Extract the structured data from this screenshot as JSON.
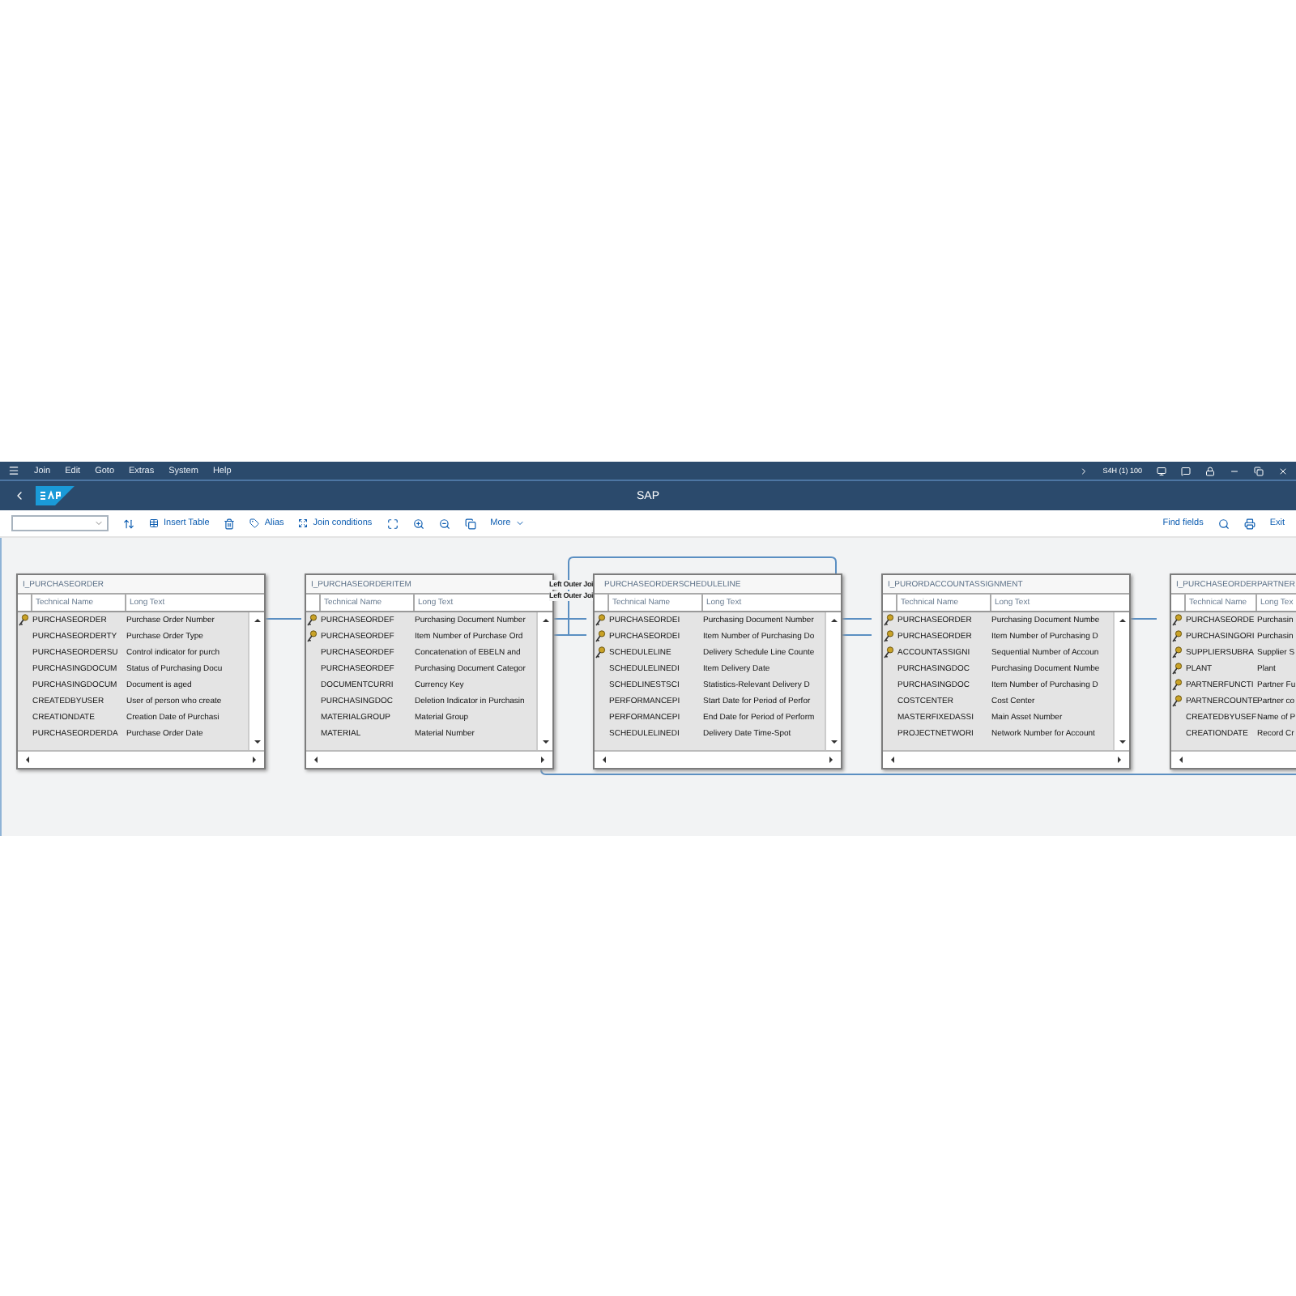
{
  "menu": [
    "Join",
    "Edit",
    "Goto",
    "Extras",
    "System",
    "Help"
  ],
  "system_info": "S4H (1) 100",
  "window": {
    "title": "SAP"
  },
  "toolbar": {
    "left": [
      {
        "kind": "select"
      },
      {
        "kind": "icon"
      },
      {
        "kind": "button",
        "label": "Insert Table"
      },
      {
        "kind": "icon"
      },
      {
        "kind": "button",
        "label": "Alias"
      },
      {
        "kind": "button",
        "label": "Join conditions"
      },
      {
        "kind": "icon"
      },
      {
        "kind": "icon"
      },
      {
        "kind": "icon"
      },
      {
        "kind": "icon"
      },
      {
        "kind": "menu",
        "label": "More"
      }
    ],
    "right": [
      {
        "kind": "link",
        "label": "Find fields"
      },
      {
        "kind": "icon"
      },
      {
        "kind": "icon"
      },
      {
        "kind": "link",
        "label": "Exit"
      }
    ]
  },
  "join_labels": [
    "Left Outer Joi",
    "Left Outer Joi"
  ],
  "tables": [
    {
      "name": "I_PURCHASEORDER",
      "columns": [
        "Technical Name",
        "Long Text"
      ],
      "rows": [
        {
          "key": true,
          "technical_name": "PURCHASEORDER",
          "long_text": "Purchase Order Number"
        },
        {
          "key": false,
          "technical_name": "PURCHASEORDERTY",
          "long_text": "Purchase Order Type"
        },
        {
          "key": false,
          "technical_name": "PURCHASEORDERSU",
          "long_text": "Control indicator for purch"
        },
        {
          "key": false,
          "technical_name": "PURCHASINGDOCUM",
          "long_text": "Status of Purchasing Docu"
        },
        {
          "key": false,
          "technical_name": "PURCHASINGDOCUM",
          "long_text": "Document is aged"
        },
        {
          "key": false,
          "technical_name": "CREATEDBYUSER",
          "long_text": "User of person who create"
        },
        {
          "key": false,
          "technical_name": "CREATIONDATE",
          "long_text": "Creation Date of Purchasi"
        },
        {
          "key": false,
          "technical_name": "PURCHASEORDERDA",
          "long_text": "Purchase Order Date"
        }
      ]
    },
    {
      "name": "I_PURCHASEORDERITEM",
      "columns": [
        "Technical Name",
        "Long Text"
      ],
      "rows": [
        {
          "key": true,
          "technical_name": "PURCHASEORDEF",
          "long_text": "Purchasing Document Number"
        },
        {
          "key": true,
          "technical_name": "PURCHASEORDEF",
          "long_text": "Item Number of Purchase Ord"
        },
        {
          "key": false,
          "technical_name": "PURCHASEORDEF",
          "long_text": "Concatenation of EBELN and"
        },
        {
          "key": false,
          "technical_name": "PURCHASEORDEF",
          "long_text": "Purchasing Document Categor"
        },
        {
          "key": false,
          "technical_name": "DOCUMENTCURRI",
          "long_text": "Currency Key"
        },
        {
          "key": false,
          "technical_name": "PURCHASINGDOC",
          "long_text": "Deletion Indicator in Purchasin"
        },
        {
          "key": false,
          "technical_name": "MATERIALGROUP",
          "long_text": "Material Group"
        },
        {
          "key": false,
          "technical_name": "MATERIAL",
          "long_text": "Material Number"
        }
      ]
    },
    {
      "name": "PURCHASEORDERSCHEDULELINE",
      "columns": [
        "Technical Name",
        "Long Text"
      ],
      "rows": [
        {
          "key": true,
          "technical_name": "PURCHASEORDEI",
          "long_text": "Purchasing Document Number"
        },
        {
          "key": true,
          "technical_name": "PURCHASEORDEI",
          "long_text": "Item Number of Purchasing Do"
        },
        {
          "key": true,
          "technical_name": "SCHEDULELINE",
          "long_text": "Delivery Schedule Line Counte"
        },
        {
          "key": false,
          "technical_name": "SCHEDULELINEDI",
          "long_text": "Item Delivery Date"
        },
        {
          "key": false,
          "technical_name": "SCHEDLINESTSCI",
          "long_text": "Statistics-Relevant Delivery D"
        },
        {
          "key": false,
          "technical_name": "PERFORMANCEPI",
          "long_text": "Start Date for Period of Perfor"
        },
        {
          "key": false,
          "technical_name": "PERFORMANCEPI",
          "long_text": "End Date for Period of Perform"
        },
        {
          "key": false,
          "technical_name": "SCHEDULELINEDI",
          "long_text": "Delivery Date Time-Spot"
        }
      ]
    },
    {
      "name": "I_PURORDACCOUNTASSIGNMENT",
      "columns": [
        "Technical Name",
        "Long Text"
      ],
      "rows": [
        {
          "key": true,
          "technical_name": "PURCHASEORDER",
          "long_text": "Purchasing Document Numbe"
        },
        {
          "key": true,
          "technical_name": "PURCHASEORDER",
          "long_text": "Item Number of Purchasing D"
        },
        {
          "key": true,
          "technical_name": "ACCOUNTASSIGNI",
          "long_text": "Sequential Number of Accoun"
        },
        {
          "key": false,
          "technical_name": "PURCHASINGDOC",
          "long_text": "Purchasing Document Numbe"
        },
        {
          "key": false,
          "technical_name": "PURCHASINGDOC",
          "long_text": "Item Number of Purchasing D"
        },
        {
          "key": false,
          "technical_name": "COSTCENTER",
          "long_text": "Cost Center"
        },
        {
          "key": false,
          "technical_name": "MASTERFIXEDASSI",
          "long_text": "Main Asset Number"
        },
        {
          "key": false,
          "technical_name": "PROJECTNETWORI",
          "long_text": "Network Number for Account"
        }
      ]
    },
    {
      "name": "I_PURCHASEORDERPARTNER",
      "columns": [
        "Technical Name",
        "Long Tex"
      ],
      "rows": [
        {
          "key": true,
          "technical_name": "PURCHASEORDE",
          "long_text": "Purchasin"
        },
        {
          "key": true,
          "technical_name": "PURCHASINGORI",
          "long_text": "Purchasin"
        },
        {
          "key": true,
          "technical_name": "SUPPLIERSUBRA",
          "long_text": "Supplier S"
        },
        {
          "key": true,
          "technical_name": "PLANT",
          "long_text": "Plant"
        },
        {
          "key": true,
          "technical_name": "PARTNERFUNCTI",
          "long_text": "Partner Fu"
        },
        {
          "key": true,
          "technical_name": "PARTNERCOUNTE",
          "long_text": "Partner co"
        },
        {
          "key": false,
          "technical_name": "CREATEDBYUSEF",
          "long_text": "Name of P"
        },
        {
          "key": false,
          "technical_name": "CREATIONDATE",
          "long_text": "Record Cr"
        }
      ]
    }
  ]
}
